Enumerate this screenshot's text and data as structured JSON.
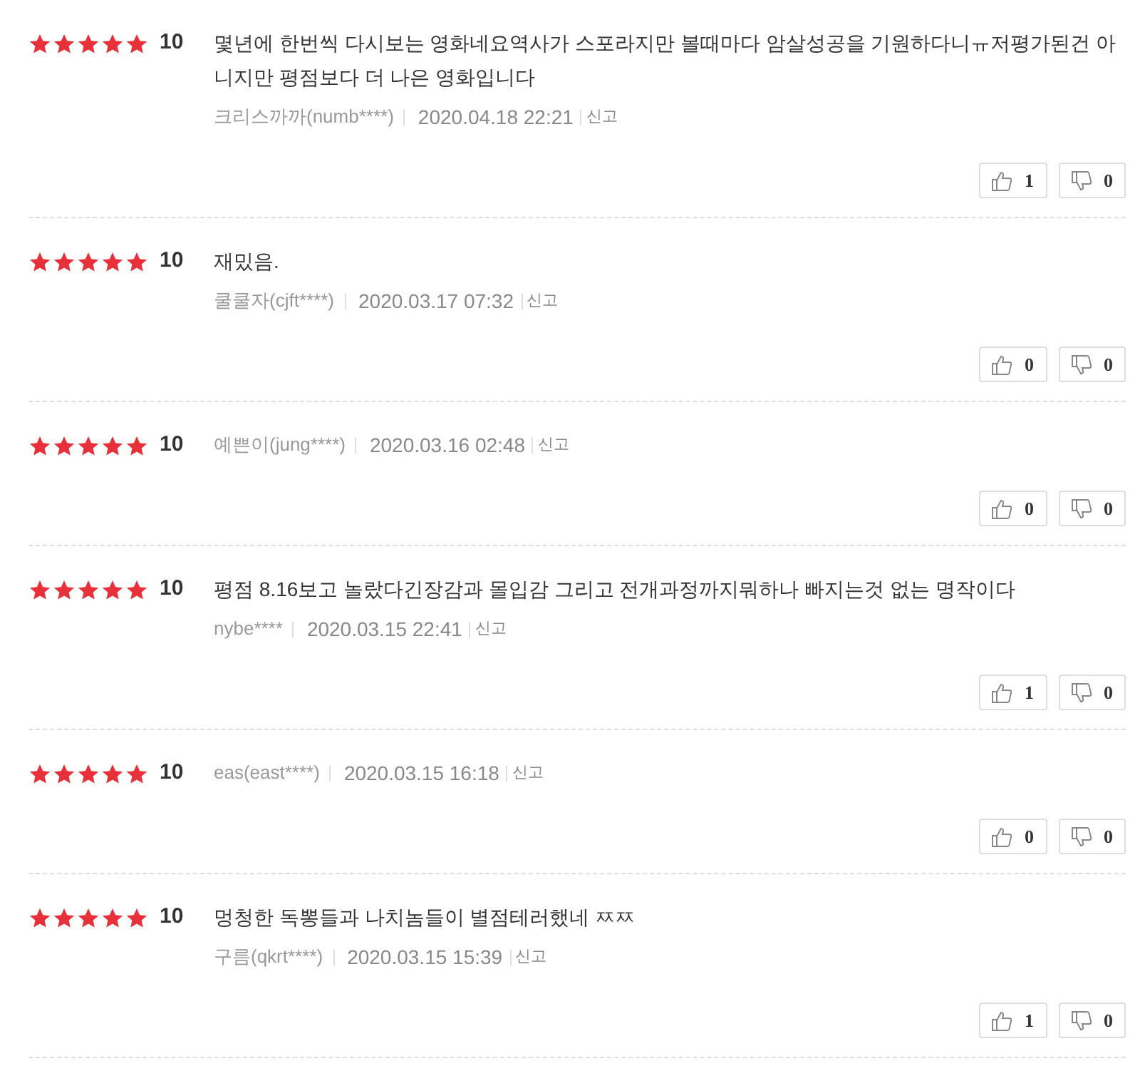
{
  "reviews": [
    {
      "stars": 5,
      "score": "10",
      "text": "몇년에 한번씩 다시보는 영화네요역사가 스포라지만 볼때마다 암살성공을 기원하다니ㅠ저평가된건 아니지만 평점보다 더 나은 영화입니다",
      "author": "크리스까까(numb****)",
      "date": "2020.04.18 22:21",
      "report": "신고",
      "likes": "1",
      "dislikes": "0"
    },
    {
      "stars": 5,
      "score": "10",
      "text": "재밌음.",
      "author": "쿨쿨자(cjft****)",
      "date": "2020.03.17 07:32",
      "report": "신고",
      "likes": "0",
      "dislikes": "0"
    },
    {
      "stars": 5,
      "score": "10",
      "author": "예쁜이(jung****)",
      "date": "2020.03.16 02:48",
      "report": "신고",
      "likes": "0",
      "dislikes": "0"
    },
    {
      "stars": 5,
      "score": "10",
      "text": "평점 8.16보고 놀랐다긴장감과 몰입감 그리고 전개과정까지뭐하나 빠지는것 없는 명작이다",
      "author": "nybe****",
      "date": "2020.03.15 22:41",
      "report": "신고",
      "likes": "1",
      "dislikes": "0"
    },
    {
      "stars": 5,
      "score": "10",
      "author": "eas(east****)",
      "date": "2020.03.15 16:18",
      "report": "신고",
      "likes": "0",
      "dislikes": "0"
    },
    {
      "stars": 5,
      "score": "10",
      "text": "멍청한 독뽕들과 나치놈들이 별점테러했네 ㅉㅉ",
      "author": "구름(qkrt****)",
      "date": "2020.03.15 15:39",
      "report": "신고",
      "likes": "1",
      "dislikes": "0"
    }
  ]
}
